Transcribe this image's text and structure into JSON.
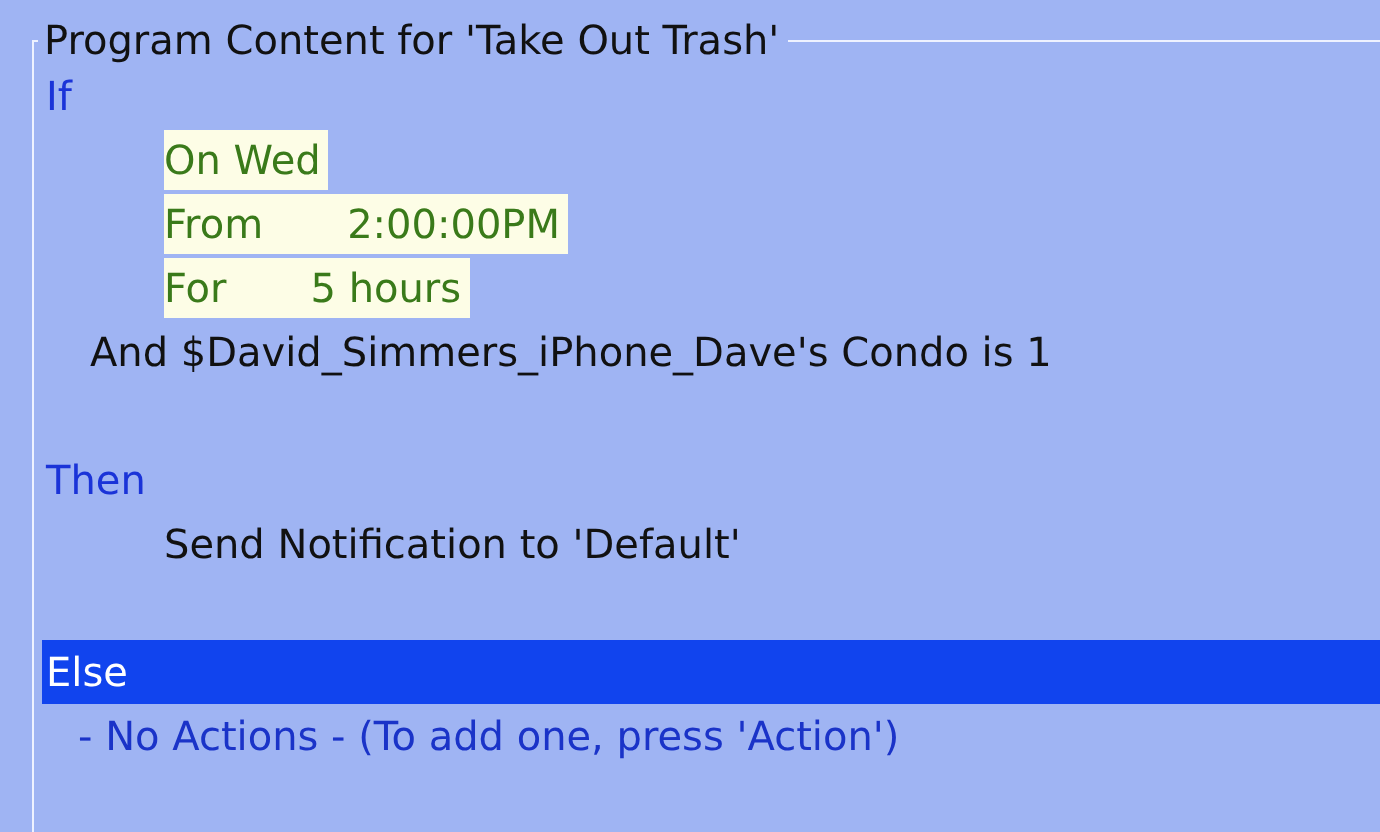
{
  "panel": {
    "title": "Program Content for 'Take Out Trash'"
  },
  "sections": [
    {
      "keyword": "If",
      "selected": false,
      "lines": [
        {
          "kind": "schedule",
          "label": "On Wed"
        },
        {
          "kind": "schedule",
          "label": "From",
          "value": "2:00:00PM"
        },
        {
          "kind": "schedule",
          "label": "For",
          "value": "5 hours"
        },
        {
          "kind": "condition",
          "label": "And $David_Simmers_iPhone_Dave's Condo is 1"
        }
      ]
    },
    {
      "keyword": "Then",
      "selected": false,
      "lines": [
        {
          "kind": "action",
          "label": "Send Notification to 'Default'"
        }
      ]
    },
    {
      "keyword": "Else",
      "selected": true,
      "lines": [
        {
          "kind": "note",
          "label": "- No Actions - (To add one, press 'Action')"
        }
      ]
    }
  ]
}
